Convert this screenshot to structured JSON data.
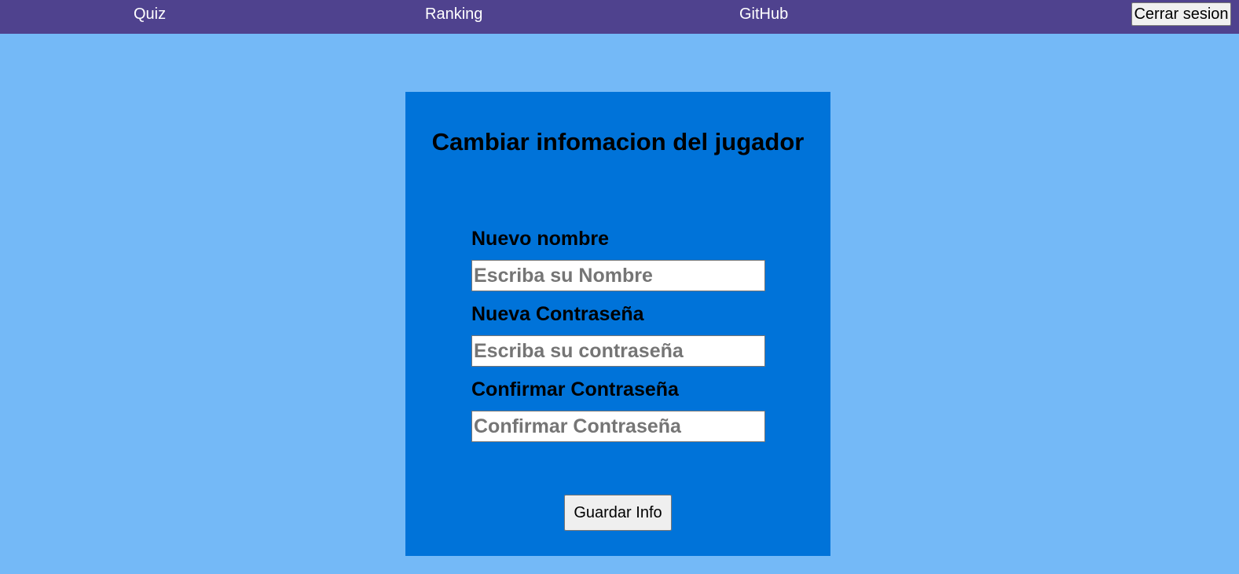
{
  "navbar": {
    "links": [
      {
        "label": "Quiz"
      },
      {
        "label": "Ranking"
      },
      {
        "label": "GitHub"
      }
    ],
    "logout_label": "Cerrar sesion"
  },
  "form": {
    "title": "Cambiar infomacion del jugador",
    "fields": [
      {
        "label": "Nuevo nombre",
        "placeholder": "Escriba su Nombre",
        "value": ""
      },
      {
        "label": "Nueva Contraseña",
        "placeholder": "Escriba su contraseña",
        "value": ""
      },
      {
        "label": "Confirmar Contraseña",
        "placeholder": "Confirmar Contraseña",
        "value": ""
      }
    ],
    "submit_label": "Guardar Info"
  },
  "colors": {
    "page_background": "#74b9f7",
    "navbar_background": "#4f428e",
    "card_background": "#0073d9"
  }
}
